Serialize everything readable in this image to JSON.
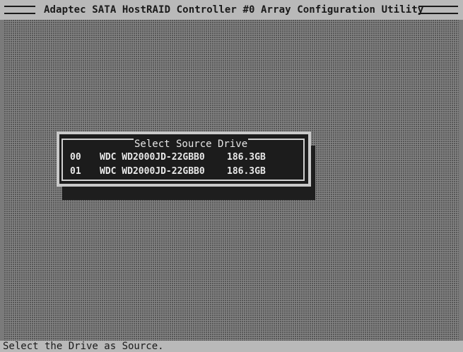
{
  "header": {
    "title": "Adaptec SATA HostRAID Controller #0 Array Configuration Utility"
  },
  "dialog": {
    "title": "Select Source Drive",
    "drives": [
      {
        "id": "00",
        "model": "WDC WD2000JD-22GBB0",
        "size": "186.3GB"
      },
      {
        "id": "01",
        "model": "WDC WD2000JD-22GBB0",
        "size": "186.3GB"
      }
    ]
  },
  "status": {
    "text": "Select the Drive as Source."
  },
  "colors": {
    "title_bar_bg": "#b9b9b9",
    "desktop_bg": "#858585",
    "dialog_bg": "#1c1c1c",
    "dialog_text": "#e8e8e8"
  }
}
